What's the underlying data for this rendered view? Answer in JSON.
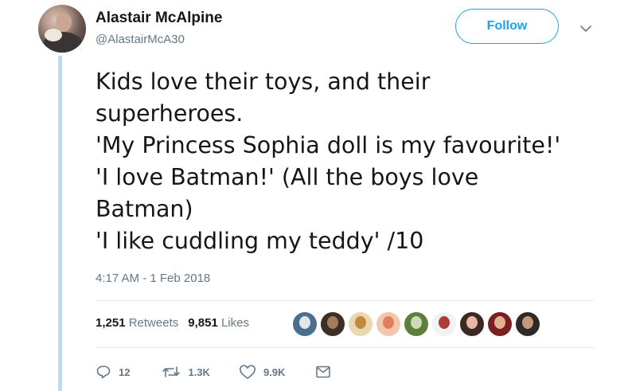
{
  "author": {
    "display_name": "Alastair McAlpine",
    "handle": "@AlastairMcA30"
  },
  "follow_label": "Follow",
  "tweet": {
    "lines": [
      "Kids love their toys, and their",
      "superheroes.",
      "'My Princess Sophia doll is my favourite!'",
      "'I love Batman!' (All the boys love",
      "Batman)",
      "'I like cuddling my teddy' /10"
    ],
    "timestamp": "4:17 AM - 1 Feb 2018"
  },
  "stats": {
    "retweets_count": "1,251",
    "retweets_label": "Retweets",
    "likes_count": "9,851",
    "likes_label": "Likes"
  },
  "likers": [
    {
      "colors": [
        "#4b6e8e",
        "#dfe7ee"
      ]
    },
    {
      "colors": [
        "#3b2f27",
        "#a47c5c"
      ]
    },
    {
      "colors": [
        "#e9d7b0",
        "#c08a40"
      ]
    },
    {
      "colors": [
        "#f3c6b0",
        "#e0805a"
      ]
    },
    {
      "colors": [
        "#5e7f3c",
        "#ced9b8"
      ]
    },
    {
      "colors": [
        "#f2f2f2",
        "#b03a3a"
      ]
    },
    {
      "colors": [
        "#3a2a22",
        "#e7b8a8"
      ]
    },
    {
      "colors": [
        "#7a1f1f",
        "#e0b090"
      ]
    },
    {
      "colors": [
        "#2e2a28",
        "#c59a7a"
      ]
    }
  ],
  "actions": {
    "replies": "12",
    "retweets": "1.3K",
    "likes": "9.9K"
  },
  "colors": {
    "accent": "#1da1f2",
    "secondary_text": "#657786",
    "thread_line": "#b8dcf3"
  },
  "icons": [
    "reply-icon",
    "retweet-icon",
    "like-icon",
    "direct-message-icon",
    "chevron-down-icon"
  ]
}
